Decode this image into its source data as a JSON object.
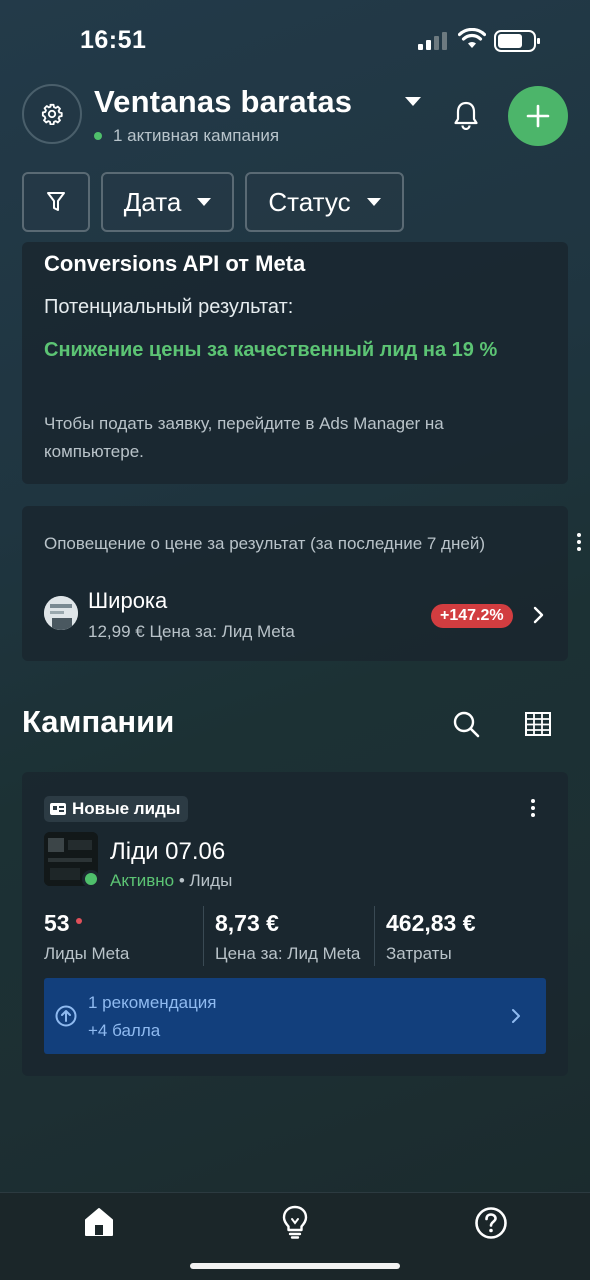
{
  "status_bar": {
    "time": "16:51"
  },
  "header": {
    "account_name": "Ventanas baratas",
    "subtitle": "1 активная кампания"
  },
  "filters": {
    "date_label": "Дата",
    "status_label": "Статус"
  },
  "capi_card": {
    "title": "Conversions API от Meta",
    "label": "Потенциальный результат:",
    "result": "Снижение цены за качественный лид на 19 %",
    "description": "Чтобы подать заявку, перейдите в Ads Manager на компьютере."
  },
  "price_alert": {
    "heading": "Оповещение о цене за результат (за последние 7 дней)",
    "item_name": "Широка",
    "item_sub": "12,99 € Цена за: Лид Meta",
    "change_badge": "+147.2%"
  },
  "campaigns": {
    "section_title": "Кампании",
    "card": {
      "tag": "Новые лиды",
      "name": "Ліди 07.06",
      "status": "Активно",
      "objective": " • Лиды",
      "metrics": [
        {
          "value": "53",
          "label": "Лиды Meta"
        },
        {
          "value": "8,73 €",
          "label": "Цена за: Лид Meta"
        },
        {
          "value": "462,83 €",
          "label": "Затраты"
        }
      ],
      "recommendation": {
        "line1": "1 рекомендация",
        "line2": "+4 балла"
      }
    }
  },
  "colors": {
    "accent_green": "#4cb56a",
    "badge_red": "#d23d40",
    "reco_blue": "#123f7c"
  },
  "icons": [
    "gear-icon",
    "bell-icon",
    "plus-icon",
    "filter-icon",
    "more-icon",
    "chevron-right-icon",
    "search-icon",
    "table-icon",
    "home-icon",
    "lightbulb-icon",
    "help-icon"
  ]
}
